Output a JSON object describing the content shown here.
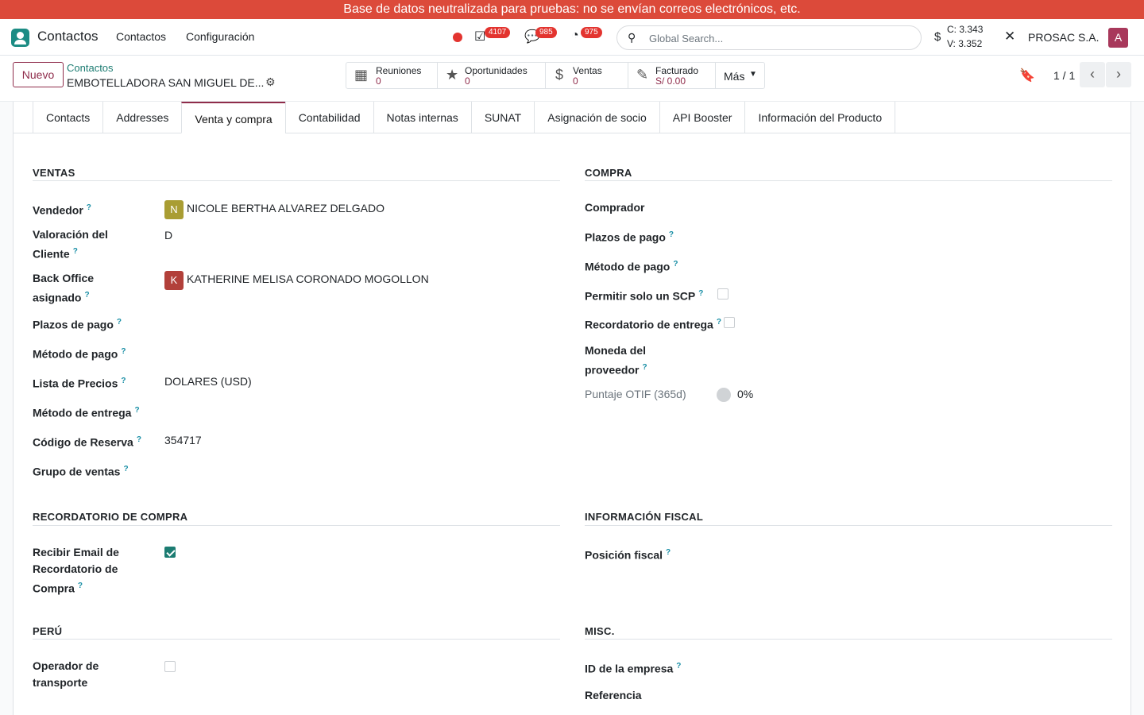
{
  "banner": {
    "text": "Base de datos neutralizada para pruebas: no se envían correos electrónicos, etc."
  },
  "navbar": {
    "app_name": "Contactos",
    "menus": [
      "Contactos",
      "Configuración"
    ],
    "badges": {
      "activities": "4107",
      "messages": "985",
      "timesheets": "975"
    },
    "search_placeholder": "Global Search...",
    "currency_symbol": "$",
    "rate_c": "C: 3.343",
    "rate_v": "V: 3.352",
    "company": "PROSAC S.A.",
    "avatar_letter": "A"
  },
  "control": {
    "new_label": "Nuevo",
    "breadcrumb_parent": "Contactos",
    "record_name": "EMBOTELLADORA SAN MIGUEL DE...",
    "smart_buttons": [
      {
        "label": "Reuniones",
        "value": "0",
        "icon": "calendar-icon"
      },
      {
        "label": "Oportunidades",
        "value": "0",
        "icon": "star-icon"
      },
      {
        "label": "Ventas",
        "value": "0",
        "icon": "dollar-icon"
      },
      {
        "label": "Facturado",
        "value": "S/ 0.00",
        "icon": "pencil-square-icon"
      }
    ],
    "more_label": "Más",
    "pager": "1 / 1"
  },
  "tabs": [
    "Contacts",
    "Addresses",
    "Venta y compra",
    "Contabilidad",
    "Notas internas",
    "SUNAT",
    "Asignación de socio",
    "API Booster",
    "Información del Producto"
  ],
  "active_tab": "Venta y compra",
  "ventas": {
    "title": "VENTAS",
    "vendedor_label": "Vendedor",
    "vendedor_initial": "N",
    "vendedor_value": "NICOLE BERTHA ALVAREZ DELGADO",
    "valoracion_label_1": "Valoración del",
    "valoracion_label_2": "Cliente",
    "valoracion_value": "D",
    "backoffice_label_1": "Back Office",
    "backoffice_label_2": "asignado",
    "backoffice_initial": "K",
    "backoffice_value": "KATHERINE MELISA CORONADO MOGOLLON",
    "plazos_label": "Plazos de pago",
    "metodo_pago_label": "Método de pago",
    "lista_precios_label": "Lista de Precios",
    "lista_precios_value": "DOLARES (USD)",
    "metodo_entrega_label": "Método de entrega",
    "codigo_reserva_label": "Código de Reserva",
    "codigo_reserva_value": "354717",
    "grupo_ventas_label": "Grupo de ventas"
  },
  "compra": {
    "title": "COMPRA",
    "comprador_label": "Comprador",
    "plazos_label": "Plazos de pago",
    "metodo_pago_label": "Método de pago",
    "scp_label": "Permitir solo un SCP",
    "scp_checked": false,
    "recordatorio_label": "Recordatorio de entrega",
    "recordatorio_checked": false,
    "moneda_label_1": "Moneda del",
    "moneda_label_2": "proveedor",
    "otif_label": "Puntaje OTIF (365d)",
    "otif_value": "0%"
  },
  "recordatorio_compra": {
    "title": "RECORDATORIO DE COMPRA",
    "label_1": "Recibir Email de",
    "label_2": "Recordatorio de",
    "label_3": "Compra",
    "checked": true
  },
  "info_fiscal": {
    "title": "INFORMACIÓN FISCAL",
    "posicion_label": "Posición fiscal"
  },
  "peru": {
    "title": "PERÚ",
    "label_1": "Operador de",
    "label_2": "transporte",
    "checked": false
  },
  "misc": {
    "title": "MISC.",
    "id_empresa_label": "ID de la empresa",
    "referencia_label": "Referencia"
  },
  "colors": {
    "brand": "#8f2c4b",
    "teal": "#1c7c72",
    "banner": "#dc4a3a",
    "badge": "#e3342f"
  }
}
